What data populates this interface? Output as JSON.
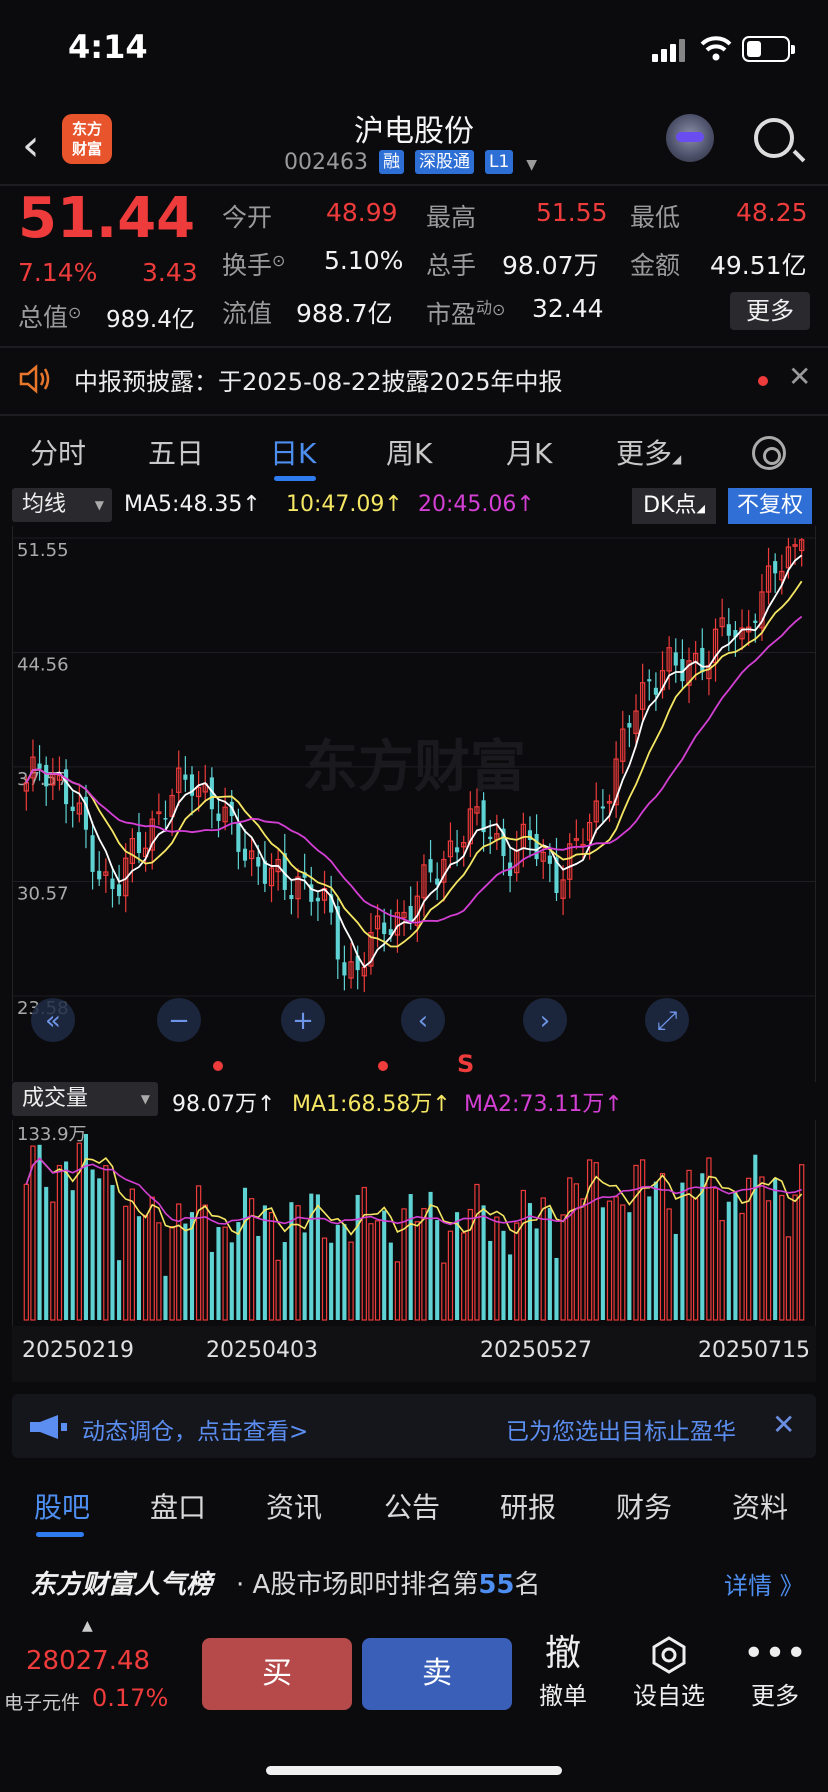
{
  "status": {
    "time": "4:14"
  },
  "header": {
    "back_icon": "chevron-left-icon",
    "logo_text": "东方\n财富",
    "title": "沪电股份",
    "code": "002463",
    "tags": [
      "融",
      "深股通",
      "L1"
    ]
  },
  "quote": {
    "price": "51.44",
    "change_pct": "7.14%",
    "change": "3.43",
    "open_label": "今开",
    "open": "48.99",
    "high_label": "最高",
    "high": "51.55",
    "low_label": "最低",
    "low": "48.25",
    "turnover_label": "换手",
    "turnover": "5.10%",
    "volume_label": "总手",
    "volume": "98.07万",
    "amount_label": "金额",
    "amount": "49.51亿",
    "mktcap_label": "总值",
    "mktcap": "989.4亿",
    "float_label": "流值",
    "float": "988.7亿",
    "pe_label": "市盈",
    "pe_sup": "动",
    "pe": "32.44",
    "more": "更多"
  },
  "notice": {
    "text": "中报预披露：于2025-08-22披露2025年中报"
  },
  "tabs": [
    "分时",
    "五日",
    "日K",
    "周K",
    "月K",
    "更多"
  ],
  "ma_bar": {
    "selector": "均线",
    "ma5": "MA5:48.35↑",
    "ma10": "10:47.09↑",
    "ma20": "20:45.06↑",
    "dk": "DK点",
    "fq": "不复权"
  },
  "kline": {
    "y_labels": [
      "51.55",
      "44.56",
      "37.57",
      "30.57",
      "23.58"
    ],
    "signal": "S"
  },
  "vol_bar": {
    "selector": "成交量",
    "vol": "98.07万↑",
    "ma1": "MA1:68.58万↑",
    "ma2": "MA2:73.11万↑",
    "max_label": "133.9万"
  },
  "dates": [
    "20250219",
    "20250403",
    "20250527",
    "20250715"
  ],
  "ad": {
    "text1": "动态调仓，点击查看>",
    "text2": "已为您选出目标止盈华"
  },
  "bottom_tabs": [
    "股吧",
    "盘口",
    "资讯",
    "公告",
    "研报",
    "财务",
    "资料"
  ],
  "rank": {
    "brand": "东方财富人气榜",
    "text_pre": "· A股市场即时排名第",
    "num": "55",
    "text_post": "名",
    "detail": "详情 》"
  },
  "footer": {
    "index_value": "28027.48",
    "index_name": "电子元件",
    "index_pct": "0.17%",
    "buy": "买",
    "sell": "卖",
    "cancel_icon": "撤",
    "cancel": "撤单",
    "watch": "设自选",
    "more": "更多"
  },
  "colors": {
    "up": "#ee3b3b",
    "down": "#5fd3d3",
    "ma5": "#ffffff",
    "ma10": "#f5e663",
    "ma20": "#d43fd4",
    "accent": "#2f7cf0"
  },
  "chart_data": {
    "type": "candlestick",
    "ylim": [
      23.58,
      51.55
    ],
    "x_ticks": [
      "20250219",
      "20250403",
      "20250527",
      "20250715"
    ],
    "series_close_approx": [
      36,
      38,
      37,
      35,
      33,
      31,
      30,
      32,
      34,
      35,
      36,
      37,
      36,
      34,
      33,
      32,
      31,
      30,
      31,
      30,
      28,
      25,
      26,
      27,
      28,
      29,
      30,
      31,
      33,
      34,
      34,
      33,
      32,
      33,
      32,
      31,
      32,
      34,
      36,
      38,
      41,
      43,
      44,
      43,
      44,
      45,
      46,
      45,
      48,
      49,
      50,
      51.44
    ],
    "volume_max": "133.9万"
  }
}
